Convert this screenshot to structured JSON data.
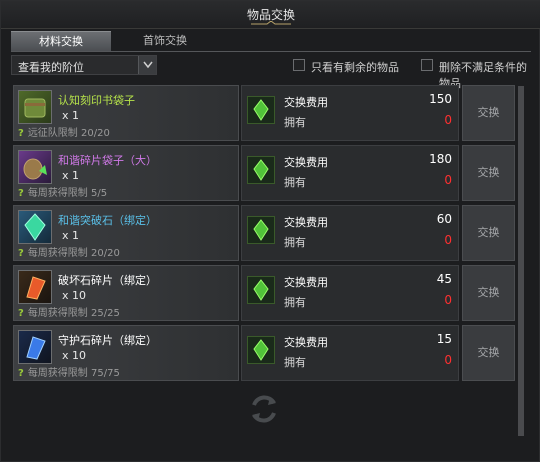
{
  "window": {
    "title": "物品交换"
  },
  "tabs": [
    {
      "label": "材料交换",
      "active": true
    },
    {
      "label": "首饰交换",
      "active": false
    }
  ],
  "filters": {
    "select_value": "查看我的阶位",
    "only_remaining_label": "只看有剩余的物品",
    "hide_unmet_label": "删除不满足条件的物品"
  },
  "common": {
    "cost_label": "交换费用",
    "owned_label": "拥有",
    "exchange_button": "交换",
    "help_mark": "?"
  },
  "items": [
    {
      "name": "认知刻印书袋子",
      "name_color": "#b6e34a",
      "qty": "x 1",
      "limit": "远征队限制 20/20",
      "cost": "150",
      "owned": "0",
      "icon": "green-bag-icon"
    },
    {
      "name": "和谐碎片袋子（大）",
      "name_color": "#d079e8",
      "qty": "x 1",
      "limit": "每周获得限制 5/5",
      "cost": "180",
      "owned": "0",
      "icon": "shard-bag-icon"
    },
    {
      "name": "和谐突破石（绑定）",
      "name_color": "#5ac0e8",
      "qty": "x 1",
      "limit": "每周获得限制 20/20",
      "cost": "60",
      "owned": "0",
      "icon": "breakthrough-stone-icon"
    },
    {
      "name": "破坏石碎片（绑定）",
      "name_color": "#ffffff",
      "qty": "x 10",
      "limit": "每周获得限制 25/25",
      "cost": "45",
      "owned": "0",
      "icon": "destruction-stone-icon"
    },
    {
      "name": "守护石碎片（绑定）",
      "name_color": "#ffffff",
      "qty": "x 10",
      "limit": "每周获得限制 75/75",
      "cost": "15",
      "owned": "0",
      "icon": "guardian-stone-icon"
    }
  ]
}
